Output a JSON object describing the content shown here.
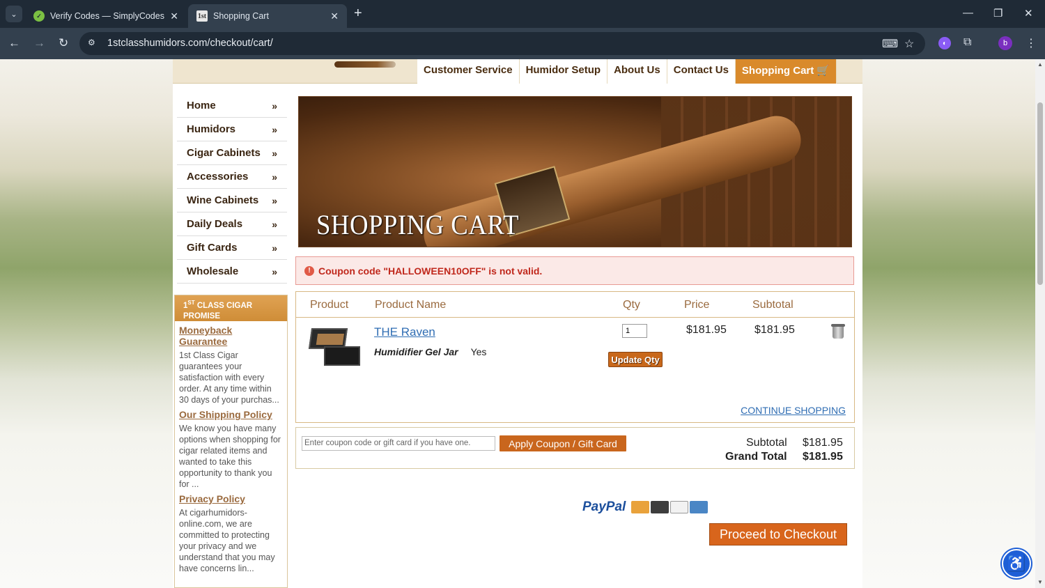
{
  "browser": {
    "tabs": [
      {
        "title": "Verify Codes — SimplyCodes",
        "icon": "simplycodes-favicon"
      },
      {
        "title": "Shopping Cart",
        "icon": "1st-favicon"
      }
    ],
    "url": "1stclasshumidors.com/checkout/cart/",
    "profile_initial": "b"
  },
  "topnav": [
    {
      "label": "Customer Service"
    },
    {
      "label": "Humidor Setup"
    },
    {
      "label": "About Us"
    },
    {
      "label": "Contact Us"
    },
    {
      "label": "Shopping Cart"
    }
  ],
  "sidebar": {
    "items": [
      {
        "label": "Home"
      },
      {
        "label": "Humidors"
      },
      {
        "label": "Cigar Cabinets"
      },
      {
        "label": "Accessories"
      },
      {
        "label": "Wine Cabinets"
      },
      {
        "label": "Daily Deals"
      },
      {
        "label": "Gift Cards"
      },
      {
        "label": "Wholesale"
      }
    ],
    "arrow": "»"
  },
  "promo": {
    "heading_prefix": "1",
    "heading_sup": "ST",
    "heading_rest": " CLASS CIGAR PROMISE",
    "sections": [
      {
        "title": "Moneyback Guarantee",
        "text": "1st Class Cigar guarantees your satisfaction with every order.  At any time within 30 days of your purchas..."
      },
      {
        "title": "Our Shipping Policy",
        "text": "We know you have many options when shopping for cigar related items and wanted to take this opportunity to thank you for ..."
      },
      {
        "title": "Privacy Policy",
        "text": "At cigarhumidors-online.com, we are committed to protecting your privacy and we understand that you may have concerns lin..."
      }
    ]
  },
  "banner": {
    "title": "SHOPPING CART"
  },
  "error": {
    "message": "Coupon code \"HALLOWEEN10OFF\" is not valid."
  },
  "cart": {
    "headers": {
      "product": "Product",
      "name": "Product Name",
      "qty": "Qty",
      "price": "Price",
      "subtotal": "Subtotal"
    },
    "item": {
      "name": "THE Raven",
      "option_label": "Humidifier Gel Jar",
      "option_value": "Yes",
      "qty": "1",
      "price": "$181.95",
      "subtotal": "$181.95"
    },
    "update_label": "Update Qty",
    "continue_label": "CONTINUE SHOPPING"
  },
  "totals": {
    "coupon_placeholder": "Enter coupon code or gift card if you have one.",
    "apply_label": "Apply Coupon / Gift Card",
    "subtotal_label": "Subtotal",
    "subtotal_value": "$181.95",
    "grand_label": "Grand Total",
    "grand_value": "$181.95"
  },
  "payment": {
    "paypal": "PayPal"
  },
  "checkout_label": "Proceed to Checkout",
  "colors": {
    "accent": "#d98a2b",
    "error": "#c0281c",
    "link": "#2f6db3"
  }
}
